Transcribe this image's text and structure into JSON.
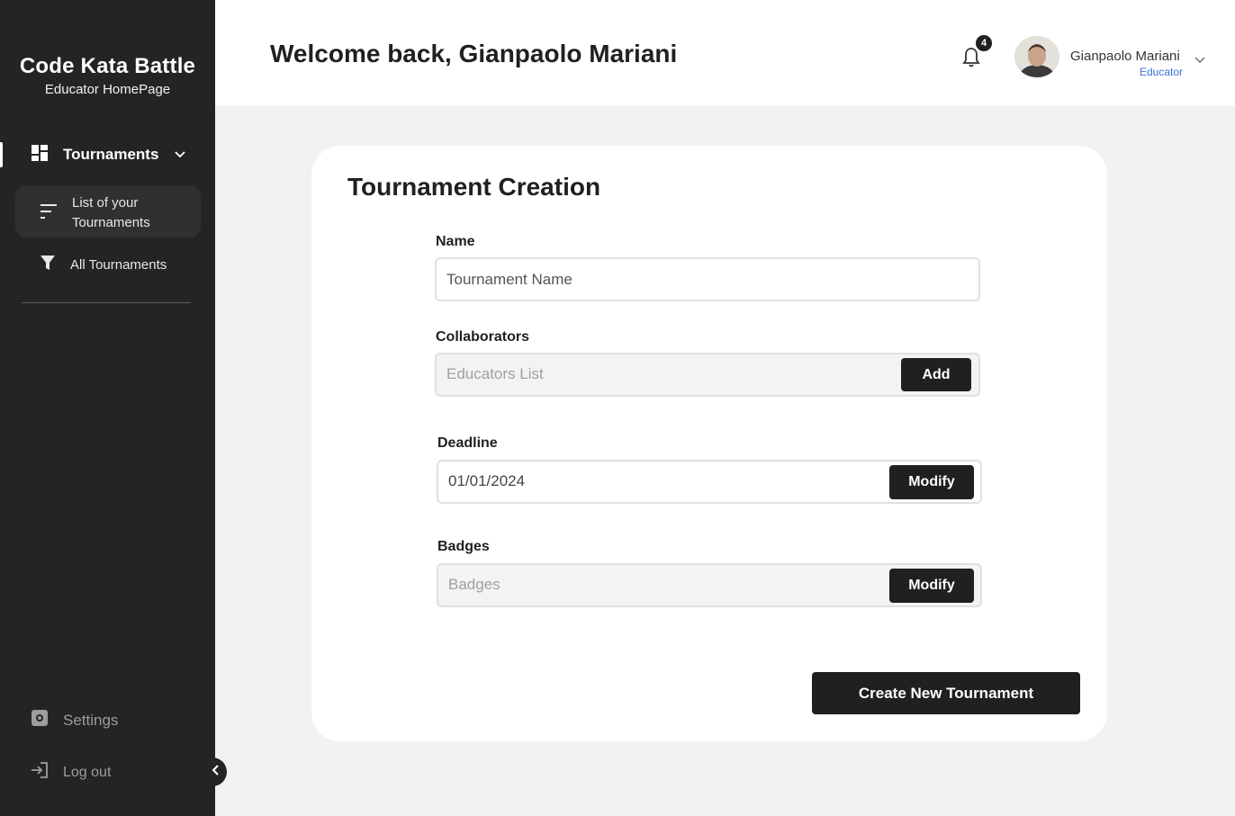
{
  "sidebar": {
    "brand_title": "Code Kata Battle",
    "brand_subtitle": "Educator HomePage",
    "nav": {
      "tournaments_label": "Tournaments",
      "list_label": "List of your Tournaments",
      "all_label": "All Tournaments"
    },
    "settings_label": "Settings",
    "logout_label": "Log out"
  },
  "header": {
    "welcome": "Welcome back, Gianpaolo Mariani",
    "notification_count": "4",
    "user_name": "Gianpaolo Mariani",
    "user_role": "Educator"
  },
  "form": {
    "title": "Tournament Creation",
    "name_label": "Name",
    "name_placeholder": "Tournament Name",
    "collaborators_label": "Collaborators",
    "collaborators_placeholder": "Educators List",
    "add_label": "Add",
    "deadline_label": "Deadline",
    "deadline_value": "01/01/2024",
    "modify_label": "Modify",
    "badges_label": "Badges",
    "badges_placeholder": "Badges",
    "create_label": "Create New Tournament"
  },
  "colors": {
    "sidebar_bg": "#222426",
    "accent_dark": "#1f2022",
    "role_blue": "#3a6fd8",
    "page_bg": "#f2f2f2"
  }
}
